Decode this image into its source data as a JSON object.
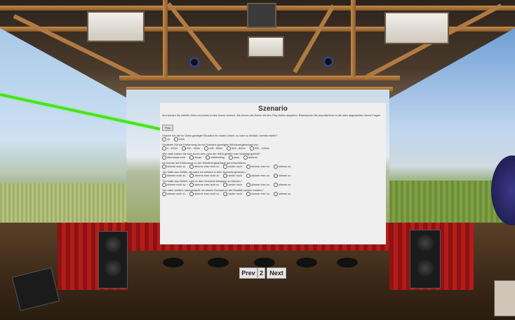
{
  "survey": {
    "title": "Szenario",
    "intro": "Nun werden Sie mithilfe Video und Audio in eine Szene versetzt. Sie können die Szene mit dem Play Button abspielen. Beantworten Sie anschließend zu die oben abgespielten Szene Fragen.",
    "play_label": "Play",
    "questions": [
      {
        "text": "\"Haben Sie die im Video gezeigte Situation im realen Leben, so oder so ähnlich, bereits erlebt?\"",
        "options": [
          "Ja",
          "Nein"
        ]
      },
      {
        "text": "Schätzen Sie die Entfernung der im Szenario gezeigten Windenergieanlage ein:",
        "options": [
          "0 - 200m",
          "200 - 400m",
          "400 - 600m",
          "600 - 800m",
          "800 - 1000m"
        ]
      },
      {
        "text": "Wie stark haben Sie sich durch den Lärm der WEA gestört oder belästigt gefühlt?",
        "options": [
          "überhaupt nicht",
          "etwas",
          "mittelmäßig",
          "stark",
          "äußerst"
        ]
      },
      {
        "text": "Ich konnte die Entfernung zu der Windenergieanlage gut einschätzen.",
        "options": [
          "stimme nicht zu",
          "stimme eher nicht zu",
          "weder noch",
          "stimme eher zu",
          "stimme zu"
        ]
      },
      {
        "text": "\"Ich hatte das Gefühl, als wäre ich wirklich in dem Szenario gewesen.\"",
        "options": [
          "stimme nicht zu",
          "stimme eher nicht zu",
          "weder noch",
          "stimme eher zu",
          "stimme zu"
        ]
      },
      {
        "text": "\"Ich hatte das Gefühl, mich in dem Szenario bewegen zu können.\"",
        "options": [
          "stimme nicht zu",
          "stimme eher nicht zu",
          "weder noch",
          "stimme eher zu",
          "stimme zu"
        ]
      },
      {
        "text": "\"Ich habe darüber nachgedacht, ob dieses Szenario in der Realität wirklich existiert.\"",
        "options": [
          "stimme nicht zu",
          "stimme eher nicht zu",
          "weder noch",
          "stimme eher zu",
          "stimme zu"
        ]
      }
    ]
  },
  "pager": {
    "prev_label": "Prev",
    "page_number": "2",
    "next_label": "Next"
  },
  "colors": {
    "laser": "#4ee01d",
    "panel_bg": "#efefef",
    "truss": "#b07a42",
    "curtain": "#b41c1c"
  }
}
